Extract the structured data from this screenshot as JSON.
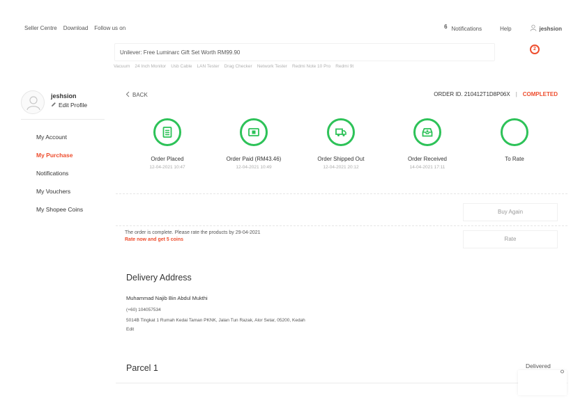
{
  "topnav": {
    "left_links": [
      "Seller Centre",
      "Download",
      "Follow us on"
    ],
    "notifications_count": "6",
    "notifications_label": "Notifications",
    "help_label": "Help",
    "username": "jeshsion"
  },
  "search": {
    "value": "Unilever: Free Luminarc Gift Set Worth RM99.90",
    "cart_count": "2",
    "hints": [
      "Vacuum",
      "24 Inch Monitor",
      "Usb Cable",
      "LAN Tester",
      "Drag Checker",
      "Network Tester",
      "Redmi Note 10 Pro",
      "Redmi 9t"
    ]
  },
  "sidebar": {
    "profile_name": "jeshsion",
    "edit_label": "Edit Profile",
    "items": [
      {
        "label": "My Account"
      },
      {
        "label": "My Purchase"
      },
      {
        "label": "Notifications"
      },
      {
        "label": "My Vouchers"
      },
      {
        "label": "My Shopee Coins"
      }
    ],
    "active_index": 1
  },
  "order": {
    "back_label": "BACK",
    "order_id": "ORDER ID. 210412T1D8P06X",
    "separator": "|",
    "status": "COMPLETED",
    "steps": [
      {
        "label": "Order Placed",
        "time": "12-04-2021 10:47",
        "icon": "receipt-icon"
      },
      {
        "label": "Order Paid (RM43.46)",
        "time": "12-04-2021 10:49",
        "icon": "payment-icon"
      },
      {
        "label": "Order Shipped Out",
        "time": "12-04-2021 20:12",
        "icon": "truck-icon"
      },
      {
        "label": "Order Received",
        "time": "14-04-2021 17:11",
        "icon": "inbox-icon"
      },
      {
        "label": "To Rate",
        "time": "",
        "icon": "star-icon"
      }
    ],
    "buy_again_label": "Buy Again",
    "complete_msg": "The order is complete. Please rate the products by 29-04-2021",
    "rate_promo": "Rate now and get 5 coins",
    "rate_label": "Rate"
  },
  "delivery": {
    "title": "Delivery Address",
    "name": "Muhammad Najib Bin Abdul Mukthi",
    "phone": "(+60) 104057534",
    "address": "5014B Tingkat 1 Rumah Kedai Taman PKNK, Jalan Tun Razak, Alor Setar, 05200, Kedah",
    "edit_label": "Edit"
  },
  "parcel": {
    "title": "Parcel 1",
    "status": "Delivered"
  },
  "colors": {
    "accent": "#ee4d2d",
    "success": "#2dc258"
  }
}
